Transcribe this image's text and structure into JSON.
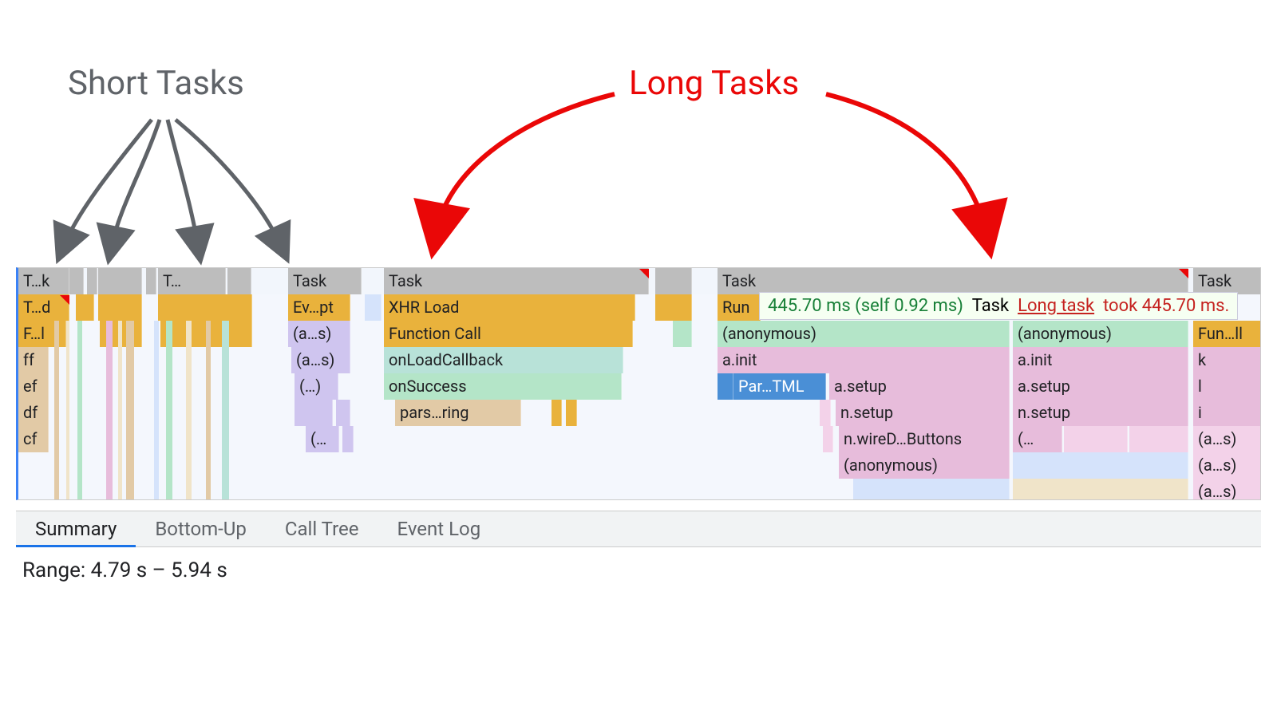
{
  "annotations": {
    "short": "Short Tasks",
    "long": "Long Tasks"
  },
  "tooltip": {
    "duration": "445.70 ms (self 0.92 ms)",
    "mid": "Task",
    "link": "Long task",
    "suffix": "took 445.70 ms."
  },
  "columns": {
    "c1": {
      "r0": "T…k",
      "r0b": "T…",
      "r1": "T…d",
      "r2": "F…l",
      "r3": "ff",
      "r4": "ef",
      "r5": "df",
      "r6": "cf"
    },
    "c2": {
      "r0": "Task",
      "r1": "Ev…pt",
      "r2": "(a…s)",
      "r3": "(a…s)",
      "r4": "(…)",
      "r5": "",
      "r6a": "(…",
      "r6b": ""
    },
    "c3": {
      "r0": "Task",
      "r1": "XHR Load",
      "r2": "Function Call",
      "r3": "onLoadCallback",
      "r4": "onSuccess",
      "r5": "pars…ring"
    },
    "c4": {
      "r0": "Task",
      "r1": "Run",
      "r2a": "(anonymous)",
      "r2b": "(anonymous)",
      "r3a": "a.init",
      "r3b": "a.init",
      "r4a": "Par…TML",
      "r4b": "a.setup",
      "r4c": "a.setup",
      "r5a": "n.setup",
      "r5b": "n.setup",
      "r6a": "n.wireD…Buttons",
      "r6b": "(…",
      "r7": "(anonymous)"
    },
    "c5": {
      "r0": "Task",
      "r2": "Fun…ll",
      "r3": "k",
      "r4": "l",
      "r5": "i",
      "r6": "(a…s)",
      "r7": "(a…s)",
      "r8": "(a…s)"
    }
  },
  "tabs": {
    "summary": "Summary",
    "bottomup": "Bottom-Up",
    "calltree": "Call Tree",
    "eventlog": "Event Log"
  },
  "range": "Range: 4.79 s – 5.94 s",
  "colors": {
    "red": "#ea0707",
    "gray": "#5f6368"
  }
}
